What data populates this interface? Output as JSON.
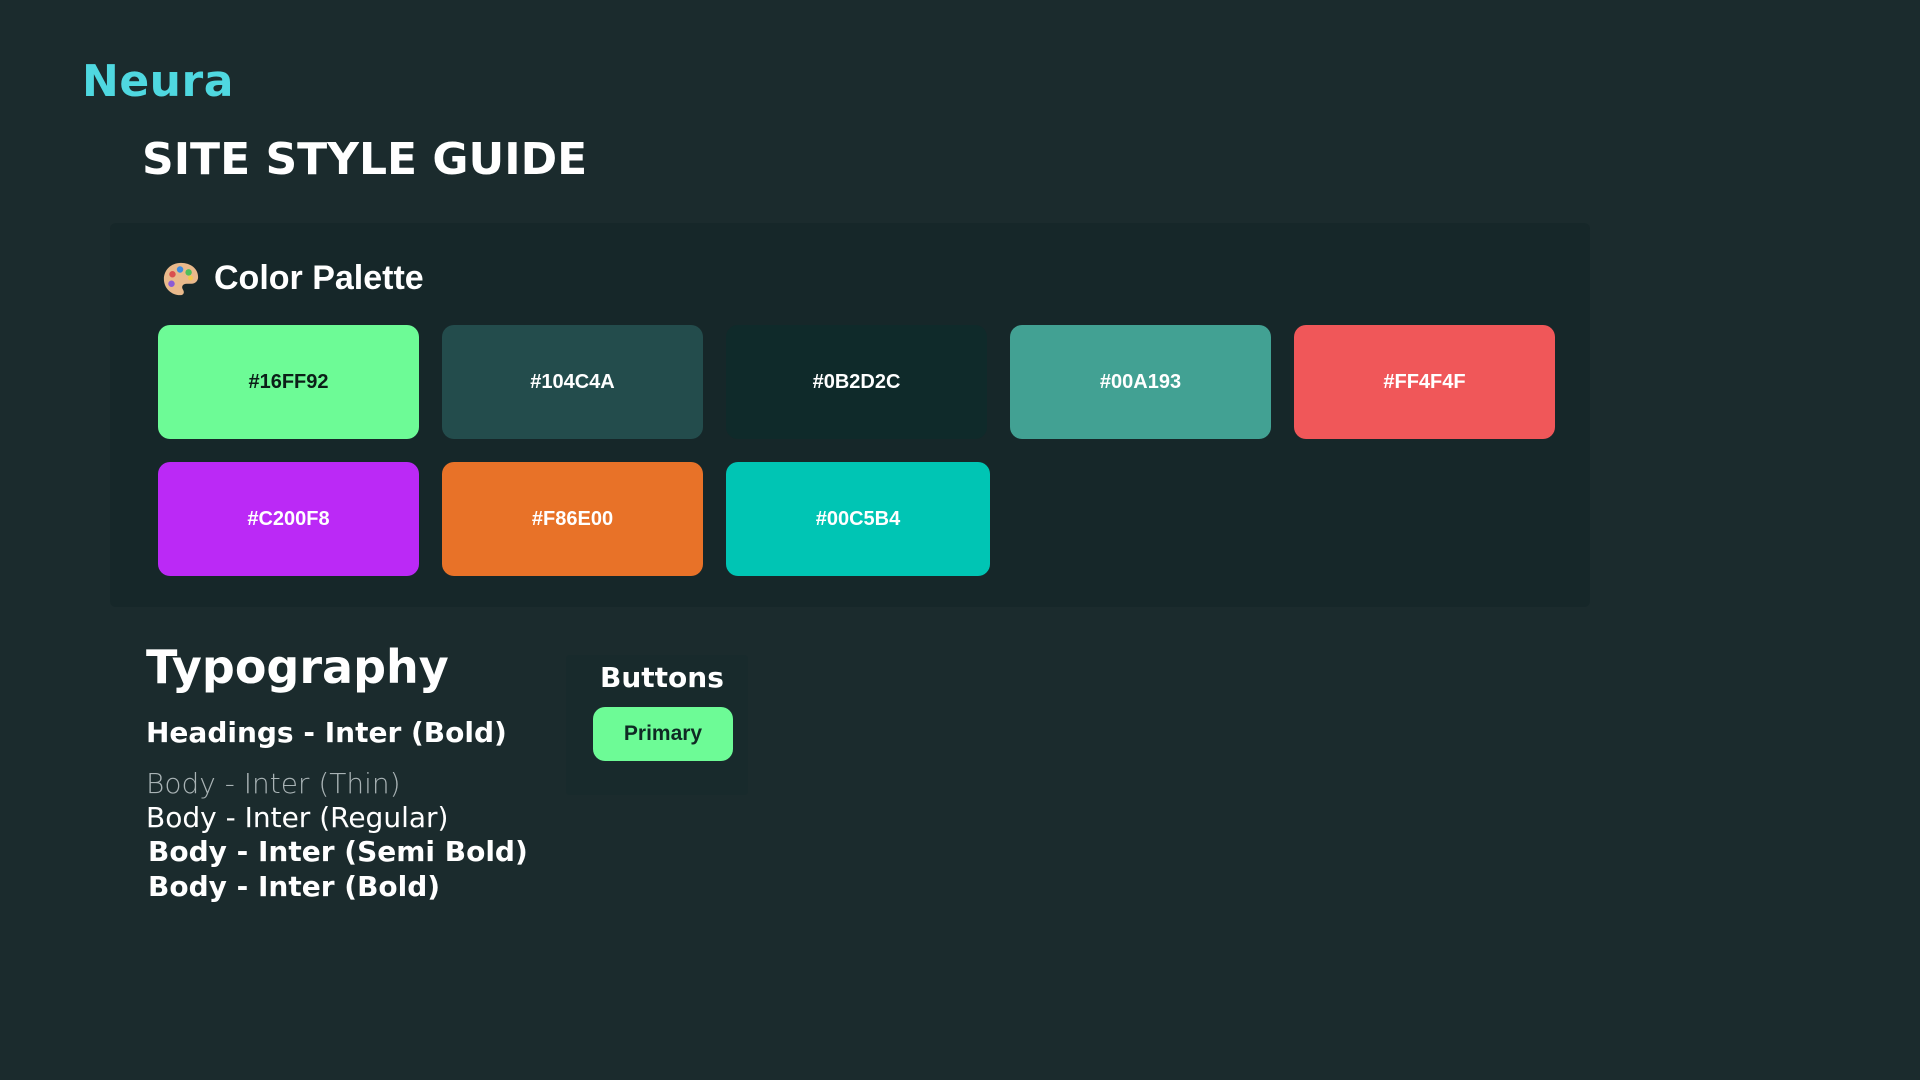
{
  "brand": "Neura",
  "title": "SITE STYLE GUIDE",
  "palette": {
    "title": "Color Palette",
    "icon": "artist-palette-icon",
    "swatches": [
      {
        "label": "#16FF92",
        "bg": "#6dfb96",
        "text": "#0b1f18"
      },
      {
        "label": "#104C4A",
        "bg": "#234c4c",
        "text": "#ffffff"
      },
      {
        "label": "#0B2D2C",
        "bg": "#0f2a2a",
        "text": "#ffffff"
      },
      {
        "label": "#00A193",
        "bg": "#42a193",
        "text": "#ffffff"
      },
      {
        "label": "#FF4F4F",
        "bg": "#f05759",
        "text": "#ffffff"
      },
      {
        "label": "#C200F8",
        "bg": "#bb29f6",
        "text": "#ffffff"
      },
      {
        "label": "#F86E00",
        "bg": "#e87228",
        "text": "#ffffff"
      },
      {
        "label": "#00C5B4",
        "bg": "#00c5b4",
        "text": "#ffffff"
      }
    ]
  },
  "typography": {
    "title": "Typography",
    "heading": "Headings - Inter (Bold)",
    "body_thin": "Body - Inter (Thin)",
    "body_regular": "Body - Inter (Regular)",
    "body_semibold": "Body - Inter (Semi Bold)",
    "body_bold": "Body - Inter (Bold)"
  },
  "buttons": {
    "title": "Buttons",
    "primary_label": "Primary"
  }
}
